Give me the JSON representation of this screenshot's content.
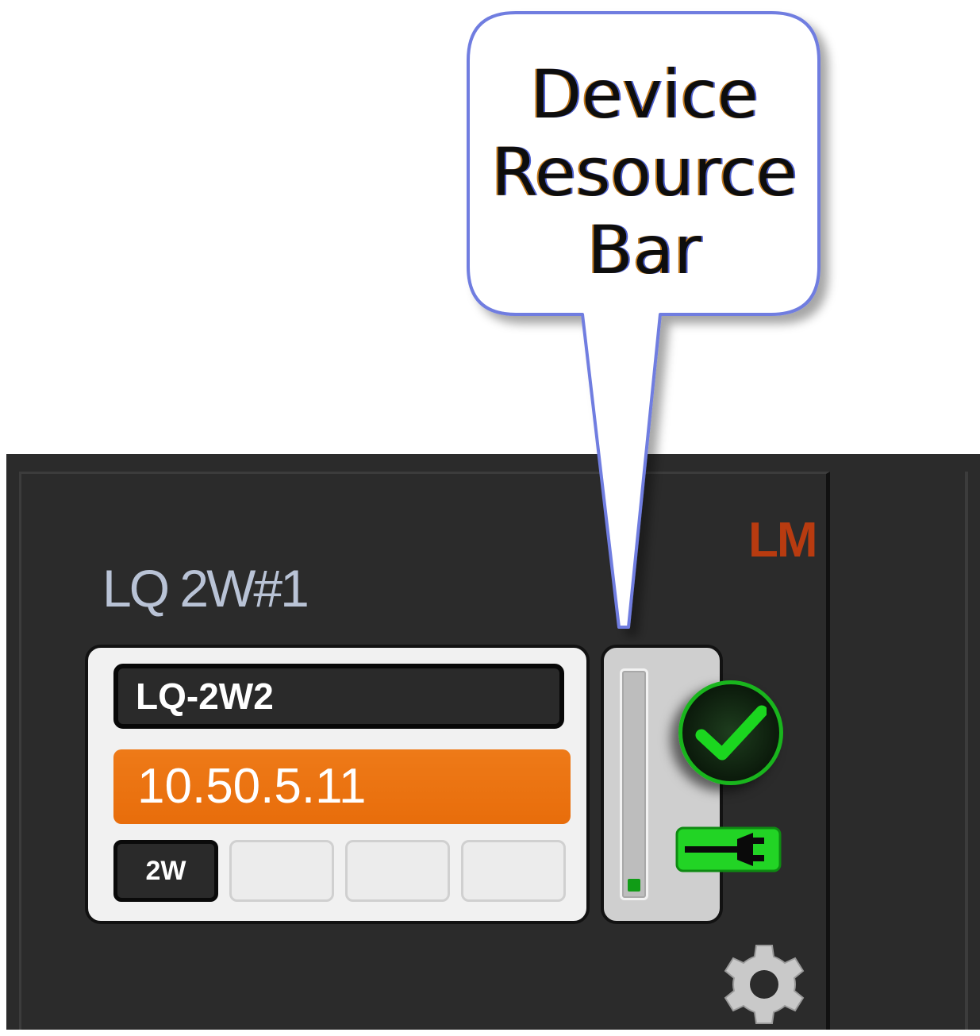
{
  "callout": {
    "lines": [
      "Device",
      "Resource",
      "Bar"
    ]
  },
  "device": {
    "badge": "LM",
    "title": "LQ 2W#1",
    "model": "LQ-2W2",
    "ip_address": "10.50.5.11",
    "slots": [
      "2W",
      "",
      "",
      ""
    ],
    "resource_level_percent": 5,
    "status": "ok",
    "colors": {
      "badge": "#b83b10",
      "ip_background": "#e8720f",
      "status_green": "#19b51d",
      "panel_background": "#2b2b2b"
    },
    "icons": [
      "check-circle-icon",
      "network-plug-icon",
      "gear-icon"
    ]
  }
}
